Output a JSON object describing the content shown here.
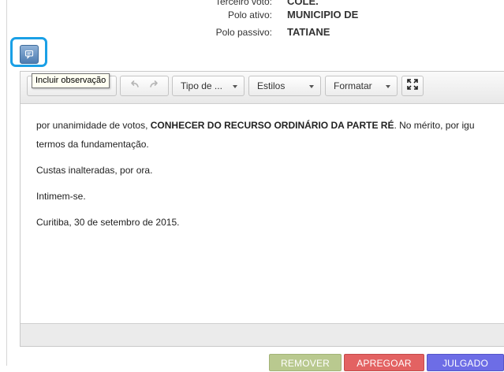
{
  "process_info": {
    "terceiro_voto": {
      "label": "Terceiro voto:",
      "value": "COLE."
    },
    "polo_ativo": {
      "label": "Polo ativo:",
      "value": "MUNICIPIO DE"
    },
    "polo_passivo": {
      "label": "Polo passivo:",
      "value": "TATIANE"
    }
  },
  "observation": {
    "button_icon": "comment-icon",
    "tooltip": "Incluir observação",
    "highlight_color": "#1aa0e6"
  },
  "toolbar": {
    "undo_icon": "undo-icon",
    "redo_icon": "redo-icon",
    "block_type_label": "Tipo de ...",
    "styles_label": "Estilos",
    "format_label": "Formatar",
    "fullscreen_icon": "fullscreen-icon"
  },
  "document": {
    "line1_prefix": "por unanimidade de votos, ",
    "line1_bold": "CONHECER DO RECURSO ORDINÁRIO DA PARTE RÉ",
    "line1_suffix": ". No mérito, por igu",
    "line2": "termos da fundamentação.",
    "para_costs": "Custas inalteradas, por ora.",
    "para_intimem": "Intimem-se.",
    "para_date": "Curitiba, 30 de setembro de 2015."
  },
  "actions": {
    "remove_label": "REMOVER",
    "pregoar_label": "APREGOAR",
    "julgado_label": "JULGADO",
    "remove_color": "#b9c98f",
    "pregoar_color": "#e36262",
    "julgado_color": "#6d6de6"
  }
}
